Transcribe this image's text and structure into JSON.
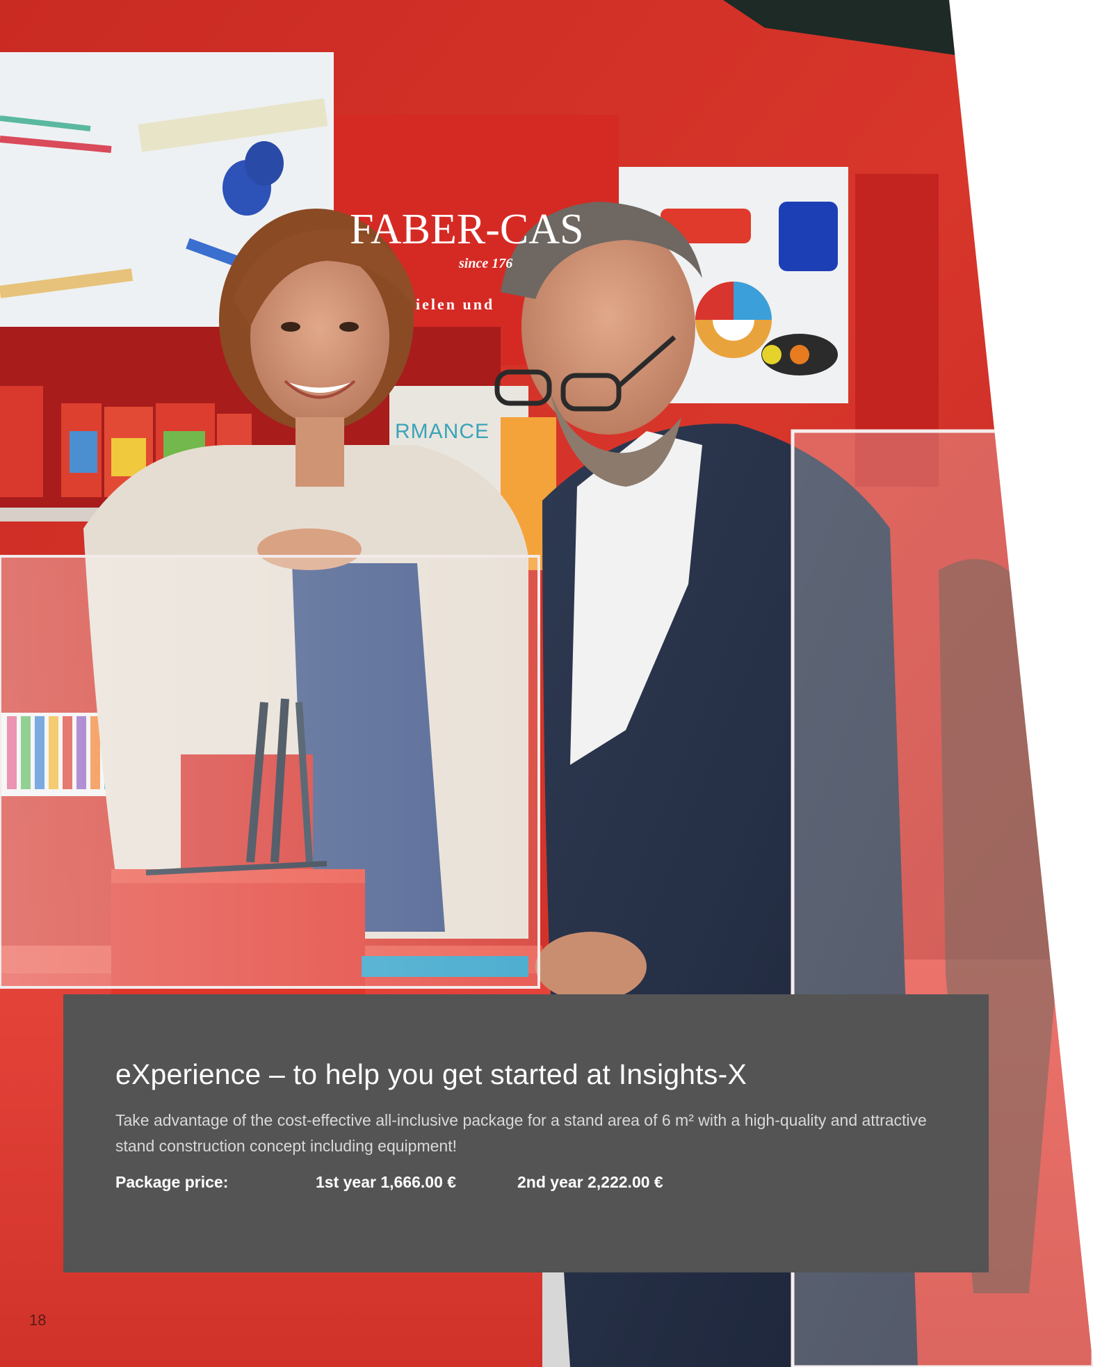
{
  "photo": {
    "brand_text": "FABER-CAS",
    "brand_since": "since 176",
    "shelf_text": "ielen und",
    "sign_text": "RMANCE"
  },
  "info": {
    "title": "eXperience – to help you get started at Insights-X",
    "description": "Take advantage of the cost-effective all-inclusive package for a stand area of 6 m² with a high-quality and attractive stand construction concept including equipment!",
    "price_label": "Package price:",
    "price_year1": "1st year 1,666.00 €",
    "price_year2": "2nd year 2,222.00 €"
  },
  "page_number": "18",
  "colors": {
    "brand_red": "#e8392c",
    "box_gray": "#545454"
  }
}
